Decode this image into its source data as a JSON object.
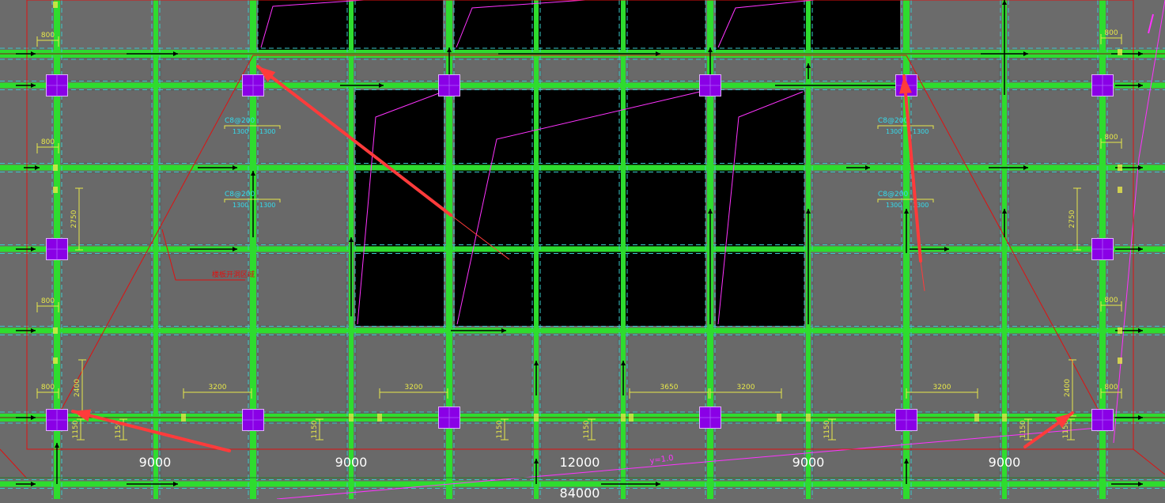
{
  "colors": {
    "background": "#6b6b6b",
    "slab_panel": "#696969",
    "beam": "#2edc2e",
    "beam_dash": "#39c8c8",
    "column": "#8a00e6",
    "column_edge": "#e0b0ff",
    "opening": "#000000",
    "dimension": "#e8e84a",
    "rebar_label": "#33ddee",
    "white_text": "#ffffff",
    "annotation_arrow": "#ff3b3b",
    "red_line": "#e01010",
    "magenta_line": "#ff33ff",
    "axis_line": "#8b1a1a"
  },
  "axes": {
    "x_spans": [
      "9000",
      "9000",
      "12000",
      "9000",
      "9000"
    ],
    "total": "84000"
  },
  "dimensions": {
    "d800": "800",
    "d2750": "2750",
    "d2400": "2400",
    "d3200": "3200",
    "d3650": "3650",
    "d1150": "1150",
    "d1300": "1300"
  },
  "rebar": {
    "label": "C8@200"
  },
  "annotations": {
    "red_note_label": "楼板开洞区域",
    "magenta_label": "y=1.0"
  },
  "icons": [
    "annotation-arrow-icon",
    "column-icon",
    "beam-direction-arrow-icon"
  ]
}
